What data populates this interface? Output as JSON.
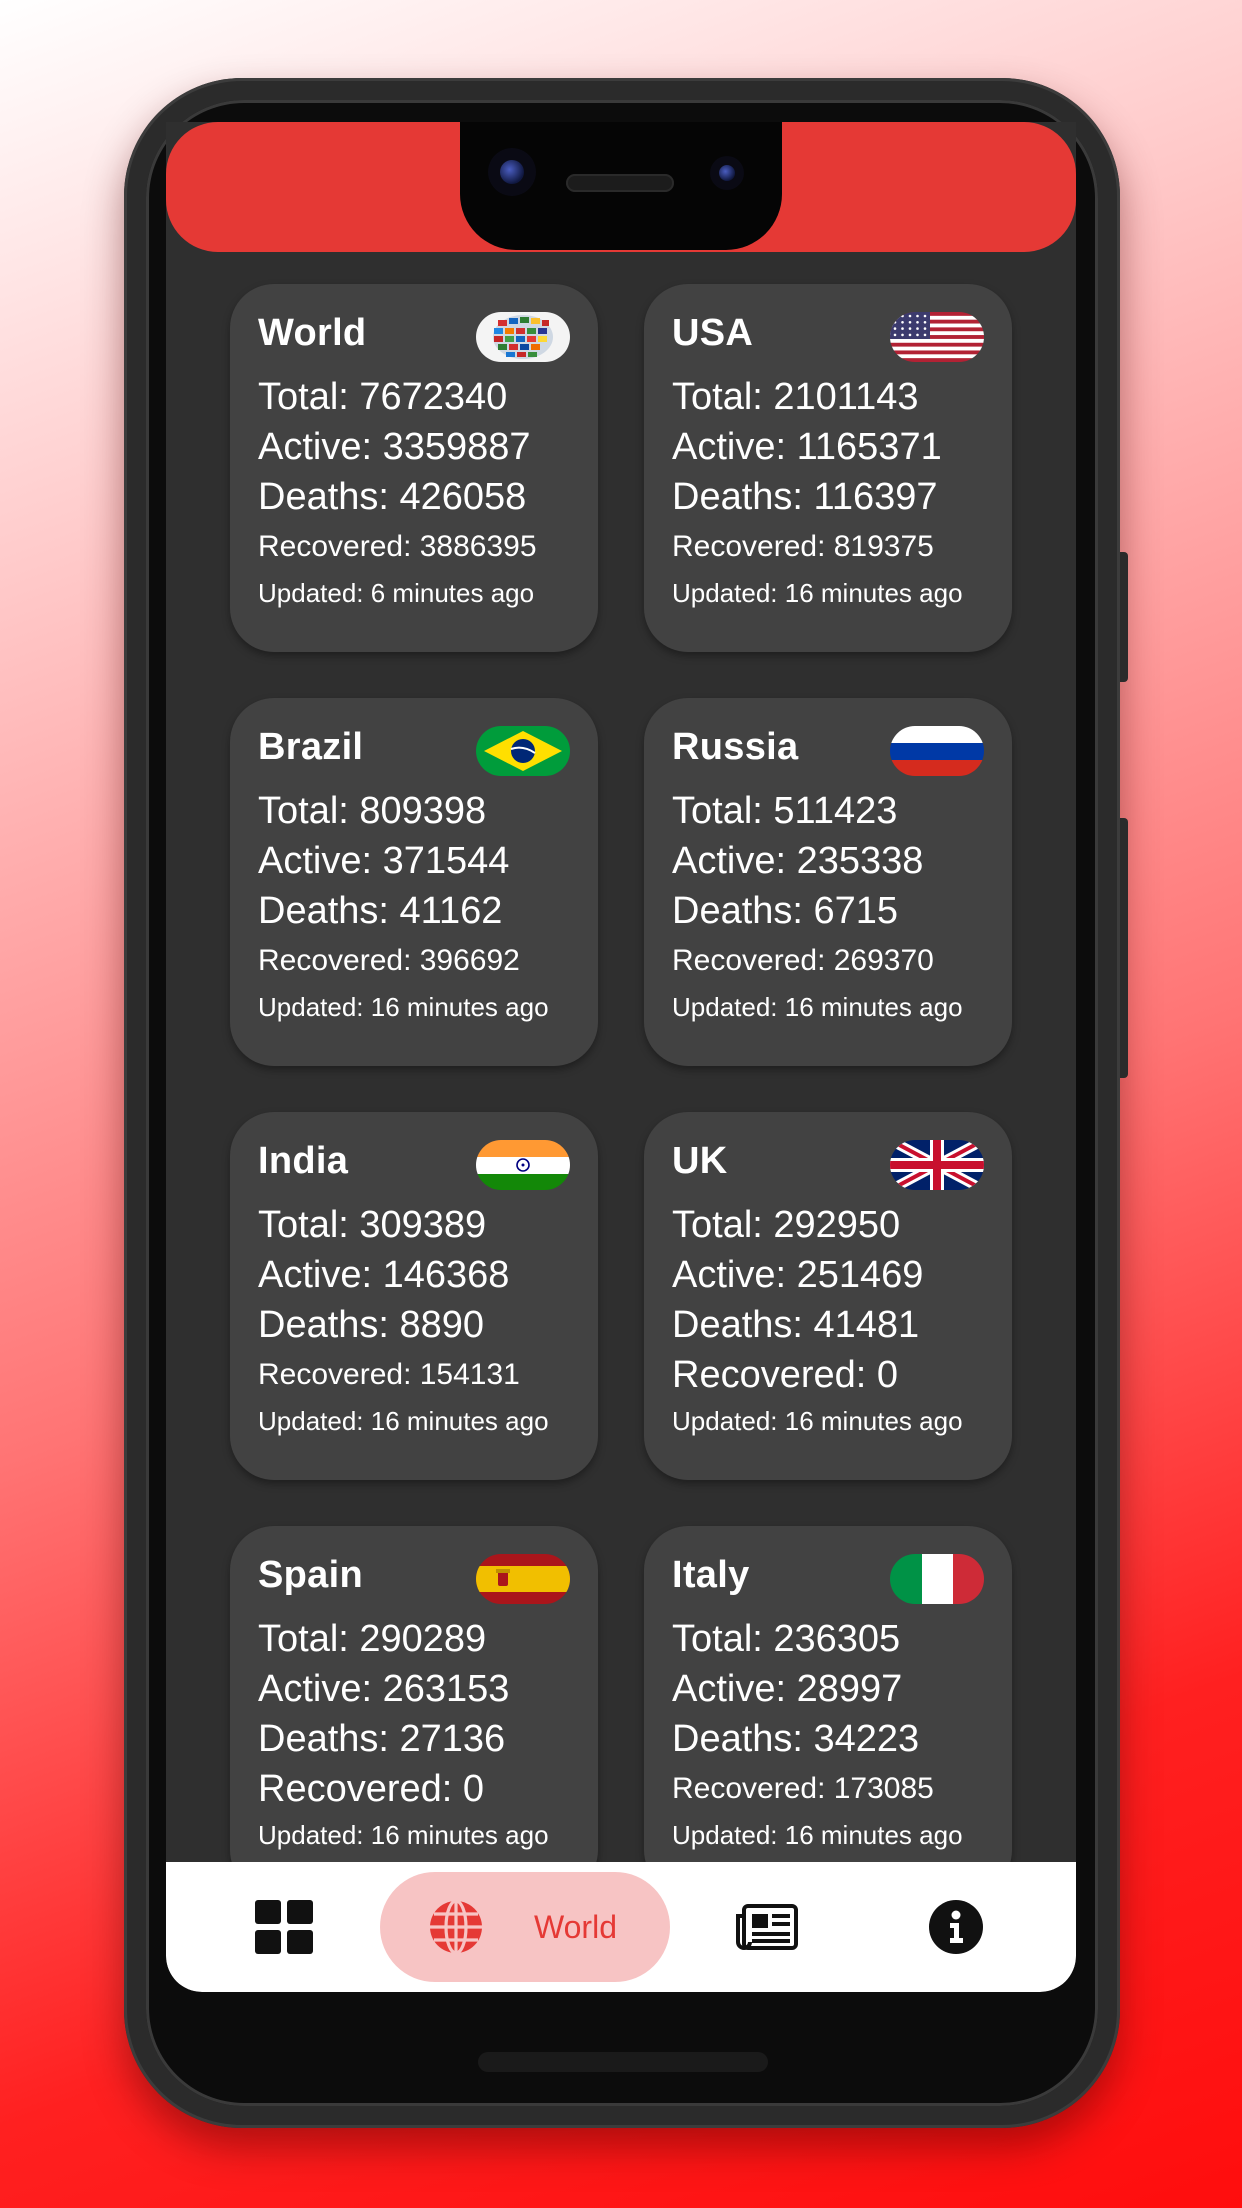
{
  "app": {
    "accent_color": "#e53935",
    "card_color": "#424242",
    "background_color": "#2f2f2f"
  },
  "cards": [
    {
      "name": "World",
      "flag": "world-flags-icon",
      "total": "Total: 7672340",
      "active": "Active: 3359887",
      "deaths": "Deaths: 426058",
      "recovered": "Recovered: 3886395",
      "updated": "Updated: 6 minutes ago"
    },
    {
      "name": "USA",
      "flag": "usa-flag-icon",
      "total": "Total: 2101143",
      "active": "Active: 1165371",
      "deaths": "Deaths: 116397",
      "recovered": "Recovered: 819375",
      "updated": "Updated: 16 minutes ago"
    },
    {
      "name": "Brazil",
      "flag": "brazil-flag-icon",
      "total": "Total: 809398",
      "active": "Active: 371544",
      "deaths": "Deaths: 41162",
      "recovered": "Recovered: 396692",
      "updated": "Updated: 16 minutes ago"
    },
    {
      "name": "Russia",
      "flag": "russia-flag-icon",
      "total": "Total: 511423",
      "active": "Active: 235338",
      "deaths": "Deaths: 6715",
      "recovered": "Recovered: 269370",
      "updated": "Updated: 16 minutes ago"
    },
    {
      "name": "India",
      "flag": "india-flag-icon",
      "total": "Total: 309389",
      "active": "Active: 146368",
      "deaths": "Deaths: 8890",
      "recovered": "Recovered: 154131",
      "updated": "Updated: 16 minutes ago"
    },
    {
      "name": "UK",
      "flag": "uk-flag-icon",
      "total": "Total: 292950",
      "active": "Active: 251469",
      "deaths": "Deaths: 41481",
      "recovered": "Recovered: 0",
      "updated": "Updated: 16 minutes ago"
    },
    {
      "name": "Spain",
      "flag": "spain-flag-icon",
      "total": "Total: 290289",
      "active": "Active: 263153",
      "deaths": "Deaths: 27136",
      "recovered": "Recovered: 0",
      "updated": "Updated: 16 minutes ago"
    },
    {
      "name": "Italy",
      "flag": "italy-flag-icon",
      "total": "Total: 236305",
      "active": "Active: 28997",
      "deaths": "Deaths: 34223",
      "recovered": "Recovered: 173085",
      "updated": "Updated: 16 minutes ago"
    }
  ],
  "bottom_nav": {
    "items": [
      {
        "icon": "dashboard-grid-icon"
      },
      {
        "icon": "globe-icon",
        "label": "World",
        "selected": true
      },
      {
        "icon": "newspaper-icon"
      },
      {
        "icon": "info-icon"
      }
    ]
  }
}
